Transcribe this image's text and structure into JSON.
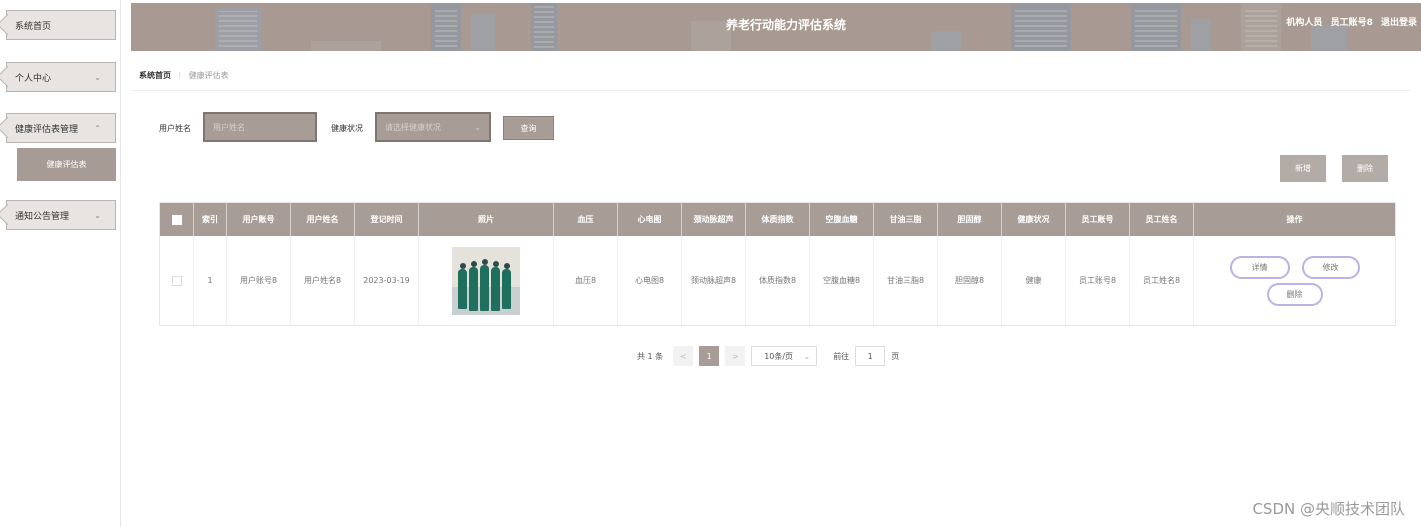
{
  "sidebar": {
    "items": [
      {
        "label": "系统首页"
      },
      {
        "label": "个人中心",
        "arrow": "⌄"
      },
      {
        "label": "健康评估表管理",
        "arrow": "⌃"
      },
      {
        "label": "通知公告管理",
        "arrow": "⌄"
      }
    ],
    "sub_item": "健康评估表"
  },
  "header": {
    "title": "养老行动能力评估系统",
    "role": "机构人员",
    "user": "员工账号8",
    "logout": "退出登录"
  },
  "breadcrumb": {
    "home": "系统首页",
    "separator": "⁝",
    "current": "健康评估表"
  },
  "search": {
    "name_label": "用户姓名",
    "name_placeholder": "用户姓名",
    "status_label": "健康状况",
    "status_placeholder": "请选择健康状况",
    "query_button": "查询"
  },
  "actions": {
    "add": "新增",
    "delete": "删除"
  },
  "table": {
    "columns": [
      "索引",
      "用户账号",
      "用户姓名",
      "登记时间",
      "照片",
      "血压",
      "心电图",
      "颈动脉超声",
      "体质指数",
      "空腹血糖",
      "甘油三脂",
      "胆固醇",
      "健康状况",
      "员工账号",
      "员工姓名",
      "操作"
    ],
    "rows": [
      {
        "index": "1",
        "account": "用户账号8",
        "name": "用户姓名8",
        "date": "2023-03-19",
        "bp": "血压8",
        "ecg": "心电图8",
        "carotid": "颈动脉超声8",
        "bmi": "体质指数8",
        "glucose": "空腹血糖8",
        "tg": "甘油三脂8",
        "chol": "胆固醇8",
        "status": "健康",
        "staff_account": "员工账号8",
        "staff_name": "员工姓名8"
      }
    ],
    "row_actions": {
      "detail": "详情",
      "edit": "修改",
      "delete": "删除"
    }
  },
  "pagination": {
    "total": "共 1 条",
    "prev": "<",
    "page": "1",
    "next": ">",
    "page_size": "10条/页",
    "goto_label": "前往",
    "goto_value": "1",
    "page_unit": "页"
  },
  "watermark": "CSDN @央顺技术团队",
  "colors": {
    "primary": "#a89d96",
    "header": "#a89a92",
    "op_border": "#b8b4e6"
  }
}
